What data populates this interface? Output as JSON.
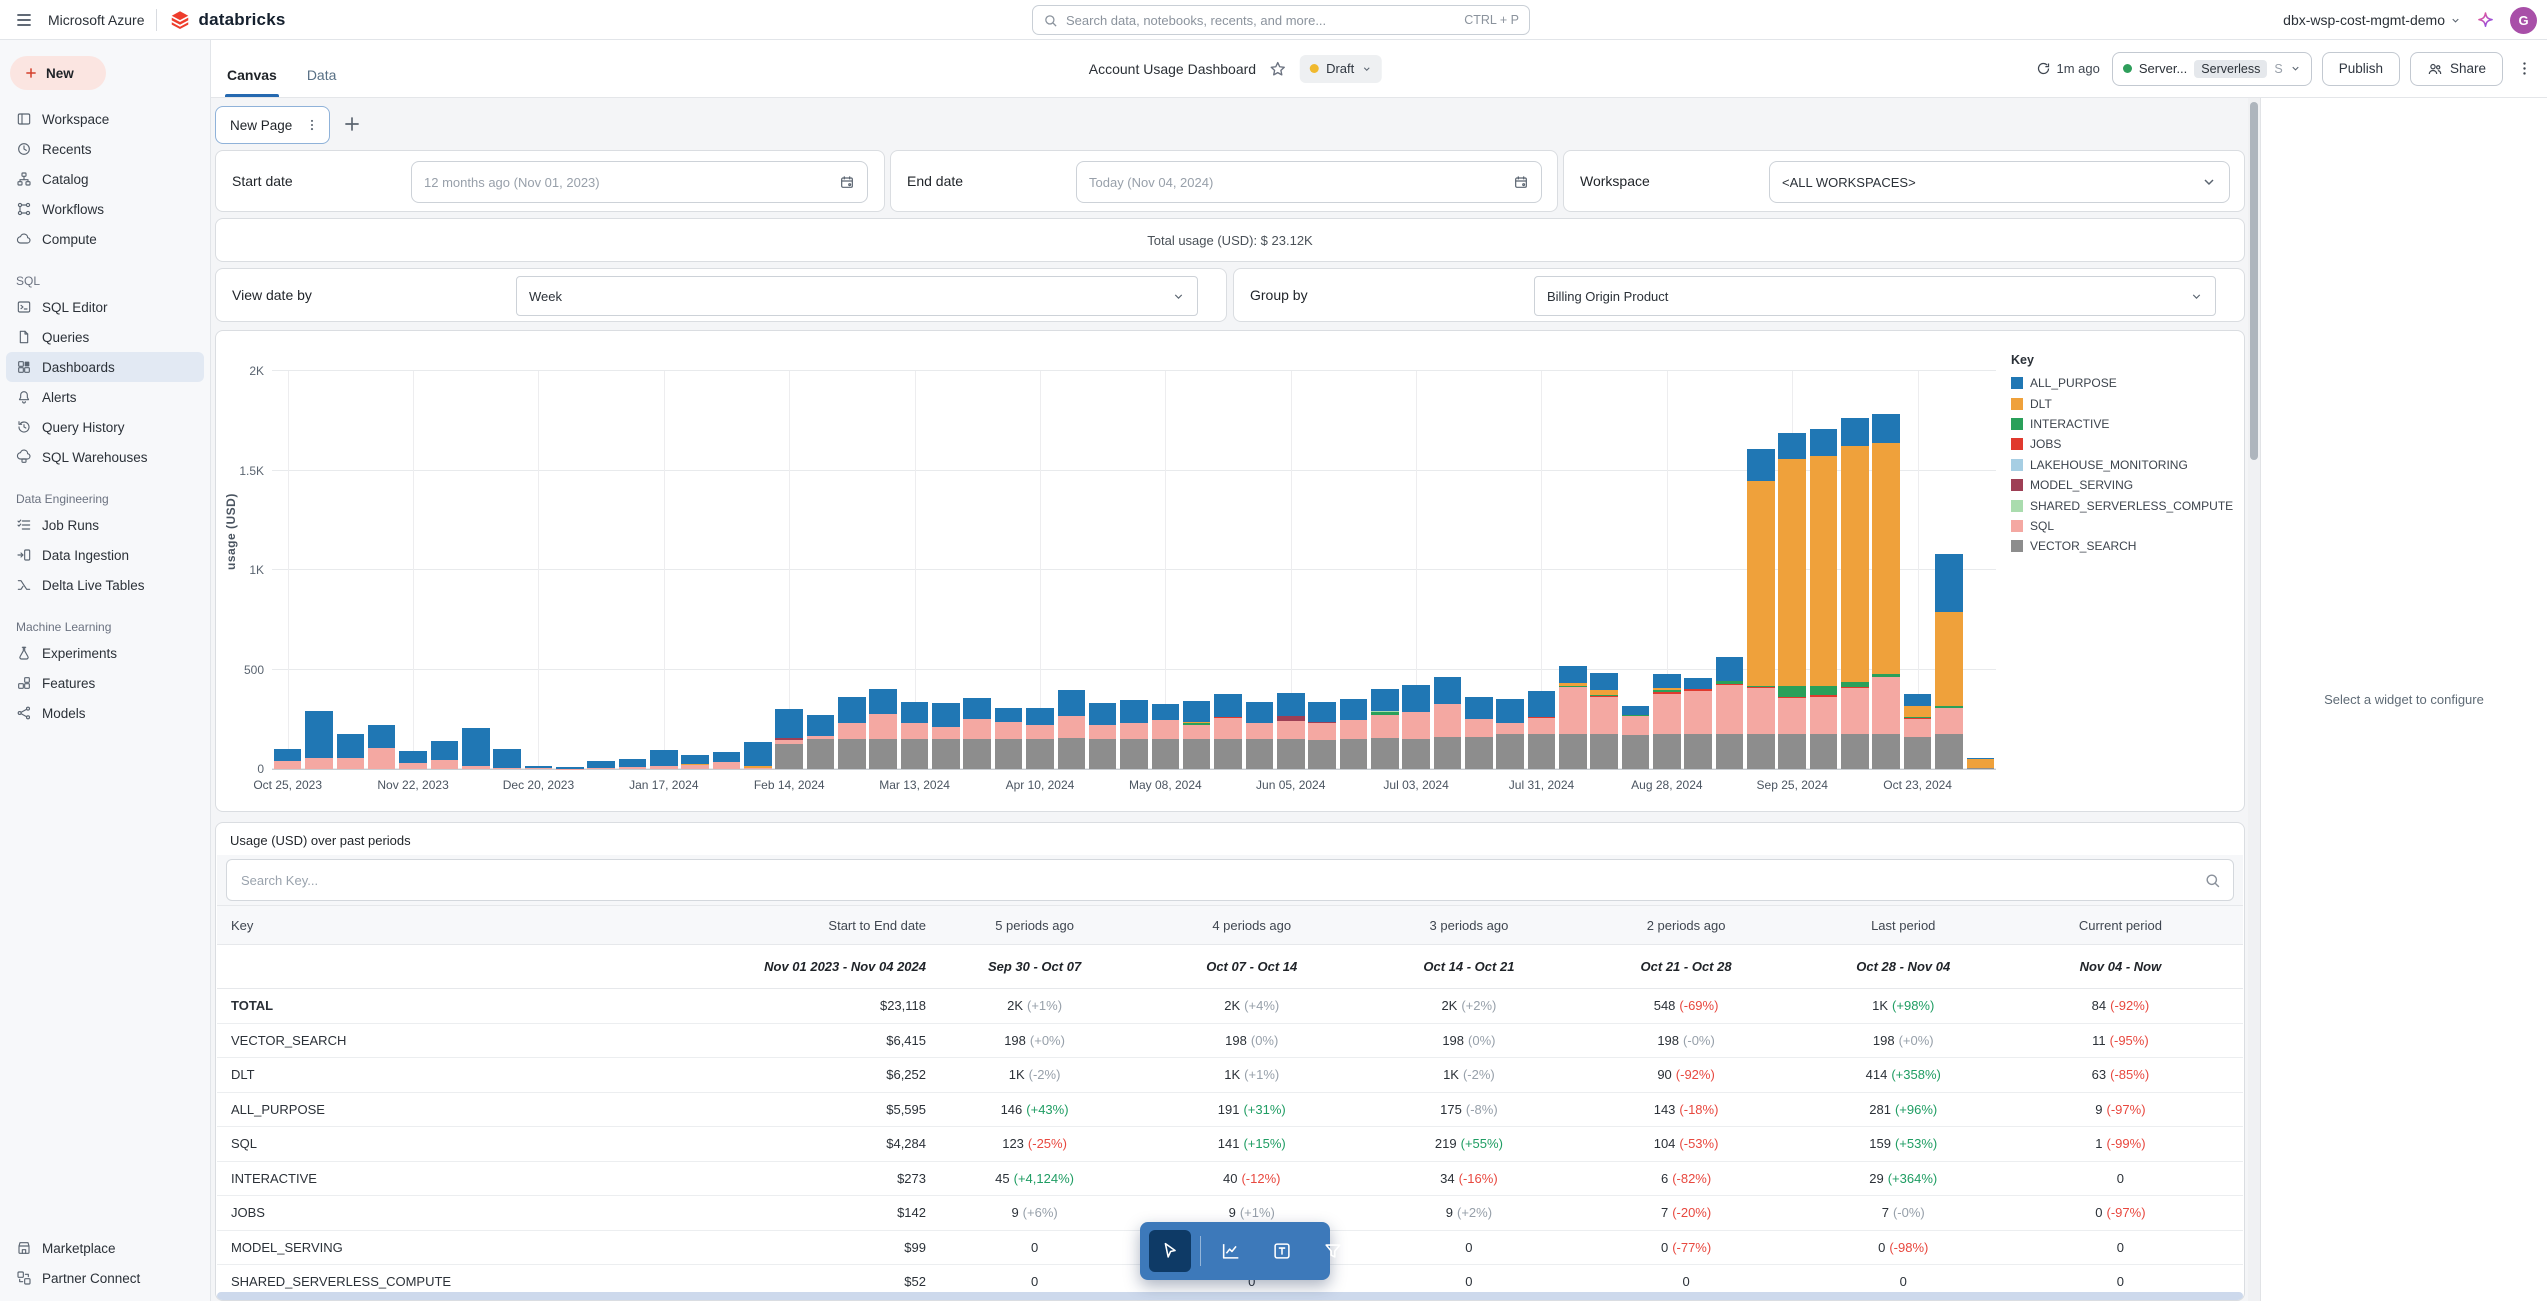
{
  "topbar": {
    "azure_label": "Microsoft Azure",
    "brand": "databricks",
    "search": {
      "placeholder": "Search data, notebooks, recents, and more...",
      "shortcut": "CTRL + P"
    },
    "workspace_name": "dbx-wsp-cost-mgmt-demo",
    "avatar_initial": "G"
  },
  "sidebar": {
    "new_label": "New",
    "sections": [
      {
        "label": null,
        "items": [
          {
            "label": "Workspace",
            "icon": "workspace"
          },
          {
            "label": "Recents",
            "icon": "recents"
          },
          {
            "label": "Catalog",
            "icon": "catalog"
          },
          {
            "label": "Workflows",
            "icon": "workflows"
          },
          {
            "label": "Compute",
            "icon": "compute"
          }
        ]
      },
      {
        "label": "SQL",
        "items": [
          {
            "label": "SQL Editor",
            "icon": "sql-editor"
          },
          {
            "label": "Queries",
            "icon": "queries"
          },
          {
            "label": "Dashboards",
            "icon": "dashboards",
            "active": true
          },
          {
            "label": "Alerts",
            "icon": "alerts"
          },
          {
            "label": "Query History",
            "icon": "query-history"
          },
          {
            "label": "SQL Warehouses",
            "icon": "sql-warehouses"
          }
        ]
      },
      {
        "label": "Data Engineering",
        "items": [
          {
            "label": "Job Runs",
            "icon": "job-runs"
          },
          {
            "label": "Data Ingestion",
            "icon": "data-ingestion"
          },
          {
            "label": "Delta Live Tables",
            "icon": "delta-live-tables"
          }
        ]
      },
      {
        "label": "Machine Learning",
        "items": [
          {
            "label": "Experiments",
            "icon": "experiments"
          },
          {
            "label": "Features",
            "icon": "features"
          },
          {
            "label": "Models",
            "icon": "models"
          }
        ]
      }
    ],
    "footer_items": [
      {
        "label": "Marketplace",
        "icon": "marketplace"
      },
      {
        "label": "Partner Connect",
        "icon": "partner-connect"
      }
    ]
  },
  "header": {
    "tab_canvas": "Canvas",
    "tab_data": "Data",
    "title": "Account Usage Dashboard",
    "status_label": "Draft",
    "refreshed": "1m ago",
    "compute_prefix": "Server...",
    "compute_chip": "Serverless",
    "compute_suffix": "S",
    "publish_label": "Publish",
    "share_label": "Share"
  },
  "canvas": {
    "new_page_label": "New Page"
  },
  "filters": {
    "start": {
      "label": "Start date",
      "value": "12 months ago (Nov 01, 2023)"
    },
    "end": {
      "label": "End date",
      "value": "Today (Nov 04, 2024)"
    },
    "workspace": {
      "label": "Workspace",
      "value": "<ALL WORKSPACES>"
    }
  },
  "summary": {
    "total_usage": "Total usage (USD): $ 23.12K"
  },
  "controls": {
    "view_date_by": {
      "label": "View date by",
      "value": "Week"
    },
    "group_by": {
      "label": "Group by",
      "value": "Billing Origin Product"
    }
  },
  "chart_data": {
    "type": "bar",
    "stacked": true,
    "ylabel": "usage (USD)",
    "ylim": [
      0,
      2000
    ],
    "ytick_values": [
      0,
      500,
      1000,
      1500,
      2000
    ],
    "ytick_labels": [
      "0",
      "500",
      "1K",
      "1.5K",
      "2K"
    ],
    "legend_title": "Key",
    "legend_position": "right",
    "grid": true,
    "x_tick_every": 4,
    "x": [
      "Oct 25, 2023",
      "Nov 01, 2023",
      "Nov 08, 2023",
      "Nov 15, 2023",
      "Nov 22, 2023",
      "Nov 29, 2023",
      "Dec 06, 2023",
      "Dec 13, 2023",
      "Dec 20, 2023",
      "Dec 27, 2023",
      "Jan 03, 2024",
      "Jan 10, 2024",
      "Jan 17, 2024",
      "Jan 24, 2024",
      "Jan 31, 2024",
      "Feb 07, 2024",
      "Feb 14, 2024",
      "Feb 21, 2024",
      "Feb 28, 2024",
      "Mar 06, 2024",
      "Mar 13, 2024",
      "Mar 20, 2024",
      "Mar 27, 2024",
      "Apr 03, 2024",
      "Apr 10, 2024",
      "Apr 17, 2024",
      "Apr 24, 2024",
      "May 01, 2024",
      "May 08, 2024",
      "May 15, 2024",
      "May 22, 2024",
      "May 29, 2024",
      "Jun 05, 2024",
      "Jun 12, 2024",
      "Jun 19, 2024",
      "Jun 26, 2024",
      "Jul 03, 2024",
      "Jul 10, 2024",
      "Jul 17, 2024",
      "Jul 24, 2024",
      "Jul 31, 2024",
      "Aug 07, 2024",
      "Aug 14, 2024",
      "Aug 21, 2024",
      "Aug 28, 2024",
      "Sep 04, 2024",
      "Sep 11, 2024",
      "Sep 18, 2024",
      "Sep 25, 2024",
      "Oct 02, 2024",
      "Oct 09, 2024",
      "Oct 16, 2024",
      "Oct 23, 2024",
      "Oct 30, 2024",
      "Nov 04, 2024"
    ],
    "stack_order": [
      "VECTOR_SEARCH",
      "SQL",
      "MODEL_SERVING",
      "JOBS",
      "INTERACTIVE",
      "SHARED_SERVERLESS_COMPUTE",
      "LAKEHOUSE_MONITORING",
      "DLT",
      "ALL_PURPOSE"
    ],
    "series": [
      {
        "name": "ALL_PURPOSE",
        "color": "#2077b4",
        "values": [
          60,
          235,
          120,
          115,
          60,
          95,
          190,
          95,
          12,
          8,
          35,
          40,
          80,
          50,
          50,
          125,
          145,
          105,
          130,
          125,
          105,
          120,
          105,
          70,
          85,
          130,
          110,
          115,
          80,
          105,
          115,
          105,
          115,
          100,
          105,
          110,
          135,
          135,
          110,
          120,
          130,
          90,
          90,
          45,
          75,
          55,
          125,
          160,
          130,
          135,
          140,
          145,
          60,
          290,
          5
        ]
      },
      {
        "name": "DLT",
        "color": "#efa13b",
        "values": [
          0,
          0,
          0,
          0,
          0,
          0,
          0,
          0,
          0,
          0,
          0,
          0,
          0,
          3,
          0,
          8,
          0,
          0,
          0,
          0,
          0,
          0,
          0,
          0,
          0,
          0,
          0,
          0,
          0,
          5,
          0,
          0,
          0,
          0,
          0,
          0,
          0,
          0,
          0,
          0,
          0,
          15,
          25,
          0,
          10,
          0,
          0,
          1030,
          1140,
          1160,
          1190,
          1160,
          55,
          475,
          45
        ]
      },
      {
        "name": "INTERACTIVE",
        "color": "#2aa05a",
        "values": [
          0,
          0,
          0,
          0,
          0,
          0,
          0,
          0,
          0,
          0,
          0,
          0,
          0,
          0,
          0,
          0,
          0,
          0,
          0,
          0,
          0,
          0,
          0,
          0,
          0,
          0,
          0,
          0,
          0,
          10,
          0,
          0,
          0,
          0,
          0,
          15,
          0,
          0,
          0,
          0,
          0,
          5,
          5,
          5,
          10,
          0,
          15,
          8,
          55,
          45,
          25,
          20,
          5,
          10,
          0
        ]
      },
      {
        "name": "JOBS",
        "color": "#e03a2e",
        "values": [
          0,
          0,
          0,
          0,
          0,
          0,
          0,
          0,
          0,
          0,
          0,
          0,
          0,
          0,
          0,
          0,
          0,
          0,
          0,
          0,
          0,
          0,
          0,
          0,
          0,
          0,
          0,
          0,
          0,
          0,
          5,
          0,
          0,
          0,
          0,
          0,
          0,
          0,
          0,
          0,
          5,
          0,
          5,
          0,
          10,
          10,
          5,
          5,
          8,
          10,
          5,
          0,
          8,
          0,
          0
        ]
      },
      {
        "name": "LAKEHOUSE_MONITORING",
        "color": "#a6cee3",
        "values": [
          0,
          0,
          0,
          0,
          0,
          0,
          0,
          0,
          0,
          0,
          0,
          0,
          0,
          0,
          0,
          0,
          0,
          0,
          0,
          0,
          0,
          0,
          0,
          0,
          0,
          0,
          0,
          0,
          0,
          0,
          0,
          0,
          0,
          0,
          0,
          0,
          0,
          0,
          0,
          0,
          0,
          0,
          0,
          0,
          0,
          0,
          0,
          0,
          0,
          0,
          0,
          0,
          0,
          0,
          0
        ]
      },
      {
        "name": "MODEL_SERVING",
        "color": "#9e3f55",
        "values": [
          0,
          0,
          0,
          0,
          0,
          0,
          0,
          0,
          0,
          0,
          0,
          0,
          0,
          0,
          0,
          0,
          10,
          0,
          0,
          0,
          0,
          0,
          0,
          0,
          0,
          0,
          0,
          0,
          0,
          0,
          0,
          0,
          25,
          8,
          0,
          0,
          0,
          0,
          0,
          0,
          0,
          0,
          0,
          0,
          0,
          0,
          0,
          0,
          0,
          0,
          0,
          0,
          0,
          0,
          0
        ]
      },
      {
        "name": "SHARED_SERVERLESS_COMPUTE",
        "color": "#aadcae",
        "values": [
          0,
          0,
          0,
          0,
          0,
          0,
          0,
          0,
          0,
          0,
          0,
          0,
          0,
          0,
          0,
          0,
          0,
          0,
          0,
          0,
          0,
          0,
          0,
          0,
          0,
          0,
          0,
          0,
          0,
          0,
          0,
          0,
          0,
          0,
          0,
          5,
          0,
          0,
          0,
          0,
          0,
          0,
          0,
          3,
          0,
          0,
          0,
          0,
          0,
          0,
          0,
          0,
          0,
          0,
          0
        ]
      },
      {
        "name": "SQL",
        "color": "#f4a8a2",
        "values": [
          40,
          55,
          55,
          105,
          30,
          45,
          15,
          5,
          3,
          2,
          5,
          10,
          15,
          20,
          35,
          5,
          20,
          15,
          80,
          125,
          80,
          60,
          100,
          85,
          70,
          110,
          70,
          80,
          95,
          70,
          105,
          80,
          90,
          85,
          95,
          115,
          135,
          165,
          90,
          55,
          80,
          235,
          185,
          95,
          200,
          215,
          245,
          230,
          180,
          185,
          230,
          285,
          90,
          130,
          0
        ]
      },
      {
        "name": "VECTOR_SEARCH",
        "color": "#8d8d8d",
        "values": [
          0,
          0,
          0,
          0,
          0,
          0,
          0,
          0,
          0,
          0,
          0,
          0,
          0,
          0,
          0,
          0,
          125,
          150,
          150,
          150,
          150,
          150,
          150,
          150,
          150,
          155,
          150,
          150,
          150,
          150,
          150,
          150,
          150,
          145,
          150,
          155,
          150,
          160,
          160,
          175,
          175,
          175,
          175,
          170,
          175,
          175,
          175,
          175,
          175,
          175,
          175,
          175,
          160,
          175,
          5
        ]
      }
    ]
  },
  "table": {
    "title": "Usage (USD) over past periods",
    "search_placeholder": "Search Key...",
    "columns": [
      "Key",
      "Start to End date",
      "5 periods ago",
      "4 periods ago",
      "3 periods ago",
      "2 periods ago",
      "Last period",
      "Current period"
    ],
    "subheader": [
      "",
      "Nov 01 2023 - Nov 04 2024",
      "Sep 30 - Oct 07",
      "Oct 07 - Oct 14",
      "Oct 14 - Oct 21",
      "Oct 21 - Oct 28",
      "Oct 28 - Nov 04",
      "Nov 04 - Now"
    ],
    "rows": [
      {
        "key": "TOTAL",
        "bold": true,
        "amount": "$23,118",
        "cells": [
          [
            "2K",
            "(+1%)",
            "neu"
          ],
          [
            "2K",
            "(+4%)",
            "neu"
          ],
          [
            "2K",
            "(+2%)",
            "neu"
          ],
          [
            "548",
            "(-69%)",
            "neg"
          ],
          [
            "1K",
            "(+98%)",
            "pos"
          ],
          [
            "84",
            "(-92%)",
            "neg"
          ]
        ]
      },
      {
        "key": "VECTOR_SEARCH",
        "amount": "$6,415",
        "cells": [
          [
            "198",
            "(+0%)",
            "neu"
          ],
          [
            "198",
            "(0%)",
            "neu"
          ],
          [
            "198",
            "(0%)",
            "neu"
          ],
          [
            "198",
            "(-0%)",
            "neu"
          ],
          [
            "198",
            "(+0%)",
            "neu"
          ],
          [
            "11",
            "(-95%)",
            "neg"
          ]
        ]
      },
      {
        "key": "DLT",
        "amount": "$6,252",
        "cells": [
          [
            "1K",
            "(-2%)",
            "neu"
          ],
          [
            "1K",
            "(+1%)",
            "neu"
          ],
          [
            "1K",
            "(-2%)",
            "neu"
          ],
          [
            "90",
            "(-92%)",
            "neg"
          ],
          [
            "414",
            "(+358%)",
            "pos"
          ],
          [
            "63",
            "(-85%)",
            "neg"
          ]
        ]
      },
      {
        "key": "ALL_PURPOSE",
        "amount": "$5,595",
        "cells": [
          [
            "146",
            "(+43%)",
            "pos"
          ],
          [
            "191",
            "(+31%)",
            "pos"
          ],
          [
            "175",
            "(-8%)",
            "neu"
          ],
          [
            "143",
            "(-18%)",
            "neg"
          ],
          [
            "281",
            "(+96%)",
            "pos"
          ],
          [
            "9",
            "(-97%)",
            "neg"
          ]
        ]
      },
      {
        "key": "SQL",
        "amount": "$4,284",
        "cells": [
          [
            "123",
            "(-25%)",
            "neg"
          ],
          [
            "141",
            "(+15%)",
            "pos"
          ],
          [
            "219",
            "(+55%)",
            "pos"
          ],
          [
            "104",
            "(-53%)",
            "neg"
          ],
          [
            "159",
            "(+53%)",
            "pos"
          ],
          [
            "1",
            "(-99%)",
            "neg"
          ]
        ]
      },
      {
        "key": "INTERACTIVE",
        "amount": "$273",
        "cells": [
          [
            "45",
            "(+4,124%)",
            "pos"
          ],
          [
            "40",
            "(-12%)",
            "neg"
          ],
          [
            "34",
            "(-16%)",
            "neg"
          ],
          [
            "6",
            "(-82%)",
            "neg"
          ],
          [
            "29",
            "(+364%)",
            "pos"
          ],
          [
            "0",
            "",
            "neu"
          ]
        ]
      },
      {
        "key": "JOBS",
        "amount": "$142",
        "cells": [
          [
            "9",
            "(+6%)",
            "neu"
          ],
          [
            "9",
            "(+1%)",
            "neu"
          ],
          [
            "9",
            "(+2%)",
            "neu"
          ],
          [
            "7",
            "(-20%)",
            "neg"
          ],
          [
            "7",
            "(-0%)",
            "neu"
          ],
          [
            "0",
            "(-97%)",
            "neg"
          ]
        ]
      },
      {
        "key": "MODEL_SERVING",
        "amount": "$99",
        "cells": [
          [
            "0",
            "",
            "neu"
          ],
          [
            "0",
            "",
            "neu"
          ],
          [
            "0",
            "",
            "neu"
          ],
          [
            "0",
            "(-77%)",
            "neg"
          ],
          [
            "0",
            "(-98%)",
            "neg"
          ],
          [
            "0",
            "",
            "neu"
          ]
        ]
      },
      {
        "key": "SHARED_SERVERLESS_COMPUTE",
        "amount": "$52",
        "cells": [
          [
            "0",
            "",
            "neu"
          ],
          [
            "0",
            "",
            "neu"
          ],
          [
            "0",
            "",
            "neu"
          ],
          [
            "0",
            "",
            "neu"
          ],
          [
            "0",
            "",
            "neu"
          ],
          [
            "0",
            "",
            "neu"
          ]
        ]
      }
    ]
  },
  "config_panel": {
    "placeholder_text": "Select a widget to configure"
  },
  "colors": {
    "accent_blue": "#2569b0",
    "brand_red": "#ee3d2c",
    "draft_yellow": "#f0b92e",
    "running_green": "#2e9e5b",
    "toolbar_blue": "#3d79ba",
    "toolbar_selected": "#0e3a66",
    "avatar_purple": "#a84fa8",
    "pct_positive": "#1f9d63",
    "pct_negative": "#e8483f",
    "pct_neutral": "#97a0aa",
    "selection_bar": "#cdd9ec"
  }
}
